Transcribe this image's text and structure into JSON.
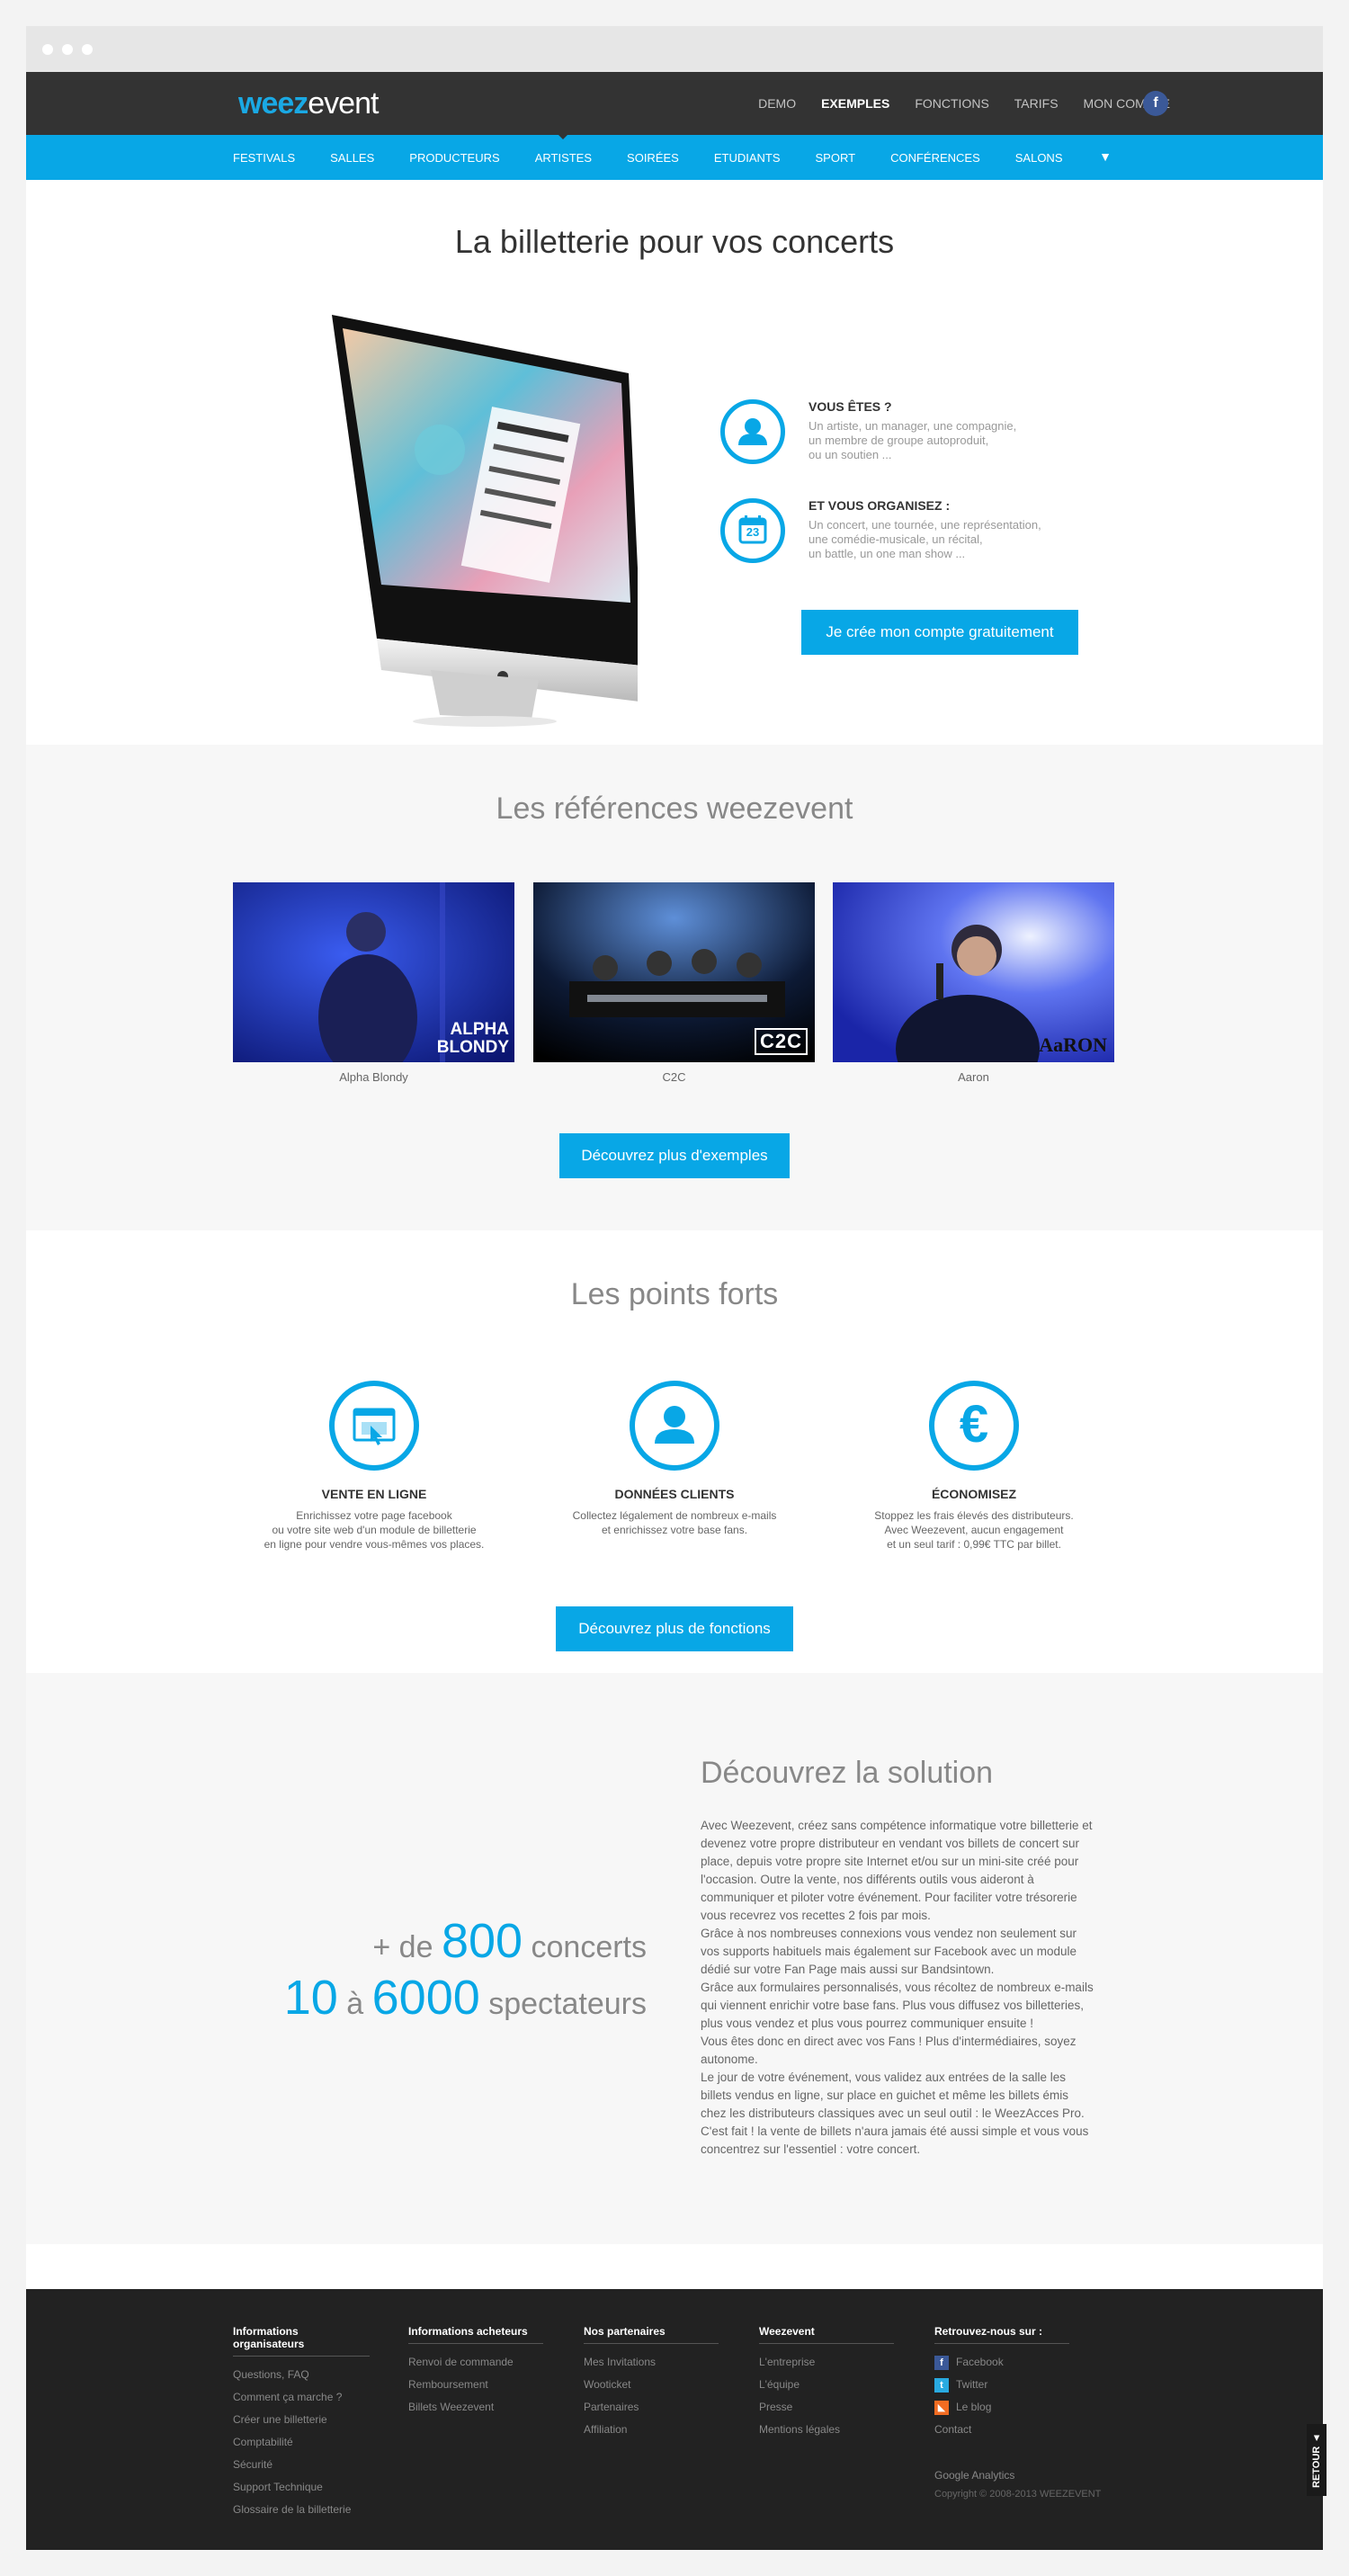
{
  "header": {
    "logo_part1": "wee",
    "logo_part2": "z",
    "logo_part3": "event",
    "nav": [
      "DEMO",
      "EXEMPLES",
      "FONCTIONS",
      "TARIFS",
      "MON COMPTE"
    ],
    "facebook_label": "f"
  },
  "categories": [
    "FESTIVALS",
    "SALLES",
    "PRODUCTEURS",
    "ARTISTES",
    "SOIRÉES",
    "ETUDIANTS",
    "SPORT",
    "CONFÉRENCES",
    "SALONS"
  ],
  "categories_arrow": "▼",
  "hero": {
    "title": "La billetterie pour vos concerts",
    "feature1_title": "VOUS ÊTES ?",
    "feature1_text": "Un artiste, un manager, une compagnie,\nun membre de groupe autoproduit,\nou un soutien ...",
    "feature2_title": "ET VOUS ORGANISEZ :",
    "feature2_text": "Un concert, une tournée, une représentation,\nune comédie-musicale, un récital,\nun battle, un one man show ...",
    "calendar_day": "23",
    "cta": "Je crée mon compte gratuitement"
  },
  "refs": {
    "title": "Les références weezevent",
    "items": [
      {
        "label": "Alpha Blondy",
        "overlay": "ALPHA\nBLONDY"
      },
      {
        "label": "C2C",
        "overlay": "C2C"
      },
      {
        "label": "Aaron",
        "overlay": "AaRON"
      }
    ],
    "cta": "Découvrez plus d'exemples"
  },
  "points": {
    "title": "Les points forts",
    "items": [
      {
        "title": "VENTE EN LIGNE",
        "text": "Enrichissez votre page facebook\nou votre site web d'un module de billetterie\nen ligne pour vendre vous-mêmes vos places."
      },
      {
        "title": "DONNÉES CLIENTS",
        "text": "Collectez légalement de nombreux e-mails\net enrichissez votre base fans."
      },
      {
        "title": "ÉCONOMISEZ",
        "text": "Stoppez les frais élevés des distributeurs.\nAvec Weezevent, aucun engagement\net un seul tarif : 0,99€ TTC par billet."
      }
    ],
    "euro_symbol": "€",
    "cta": "Découvrez plus de fonctions"
  },
  "solution": {
    "stat1_prefix": "+ de",
    "stat1_number": "800",
    "stat1_suffix": "concerts",
    "stat2_from": "10",
    "stat2_connector": "à",
    "stat2_to": "6000",
    "stat2_suffix": "spectateurs",
    "title": "Découvrez la solution",
    "text": "Avec Weezevent, créez sans compétence informatique votre billetterie et devenez votre propre distributeur en vendant vos billets de concert sur place, depuis votre propre site Internet et/ou sur un mini-site créé pour l'occasion. Outre la vente, nos différents outils vous aideront à communiquer et piloter votre événement. Pour faciliter votre trésorerie vous recevrez vos recettes 2 fois par mois.\nGrâce à nos nombreuses connexions vous vendez non seulement sur vos supports habituels mais également sur Facebook avec un module dédié sur votre Fan Page mais aussi sur Bandsintown.\nGrâce aux formulaires personnalisés, vous récoltez de nombreux e-mails qui viennent enrichir votre base fans. Plus vous diffusez vos billetteries, plus vous vendez et plus vous pourrez communiquer ensuite !\nVous êtes donc en direct avec vos Fans ! Plus d'intermédiaires, soyez autonome.\nLe jour de votre événement, vous validez aux entrées de la salle les billets vendus en ligne, sur place en guichet et même les billets émis chez les distributeurs classiques avec un seul outil : le WeezAcces Pro. C'est fait ! la vente de billets n'aura jamais été aussi simple et vous vous concentrez sur l'essentiel : votre concert."
  },
  "footer": {
    "col1": {
      "title": "Informations organisateurs",
      "links": [
        "Questions, FAQ",
        "Comment ça marche ?",
        "Créer une billetterie",
        "Comptabilité",
        "Sécurité",
        "Support Technique",
        "Glossaire de la billetterie"
      ]
    },
    "col2": {
      "title": "Informations acheteurs",
      "links": [
        "Renvoi de commande",
        "Remboursement",
        "Billets Weezevent"
      ]
    },
    "col3": {
      "title": "Nos partenaires",
      "links": [
        "Mes Invitations",
        "Wooticket",
        "Partenaires",
        "Affiliation"
      ]
    },
    "col4": {
      "title": "Weezevent",
      "links": [
        "L'entreprise",
        "L'équipe",
        "Presse",
        "Mentions légales"
      ]
    },
    "col5": {
      "title": "Retrouvez-nous sur :",
      "facebook": "Facebook",
      "twitter": "Twitter",
      "blog": "Le blog",
      "contact": "Contact"
    },
    "analytics": "Google Analytics",
    "copyright": "Copyright © 2008-2013 WEEZEVENT",
    "retour": "RETOUR ▲"
  },
  "colors": {
    "accent": "#08a7e6",
    "dark": "#333333",
    "footer": "#222222"
  }
}
